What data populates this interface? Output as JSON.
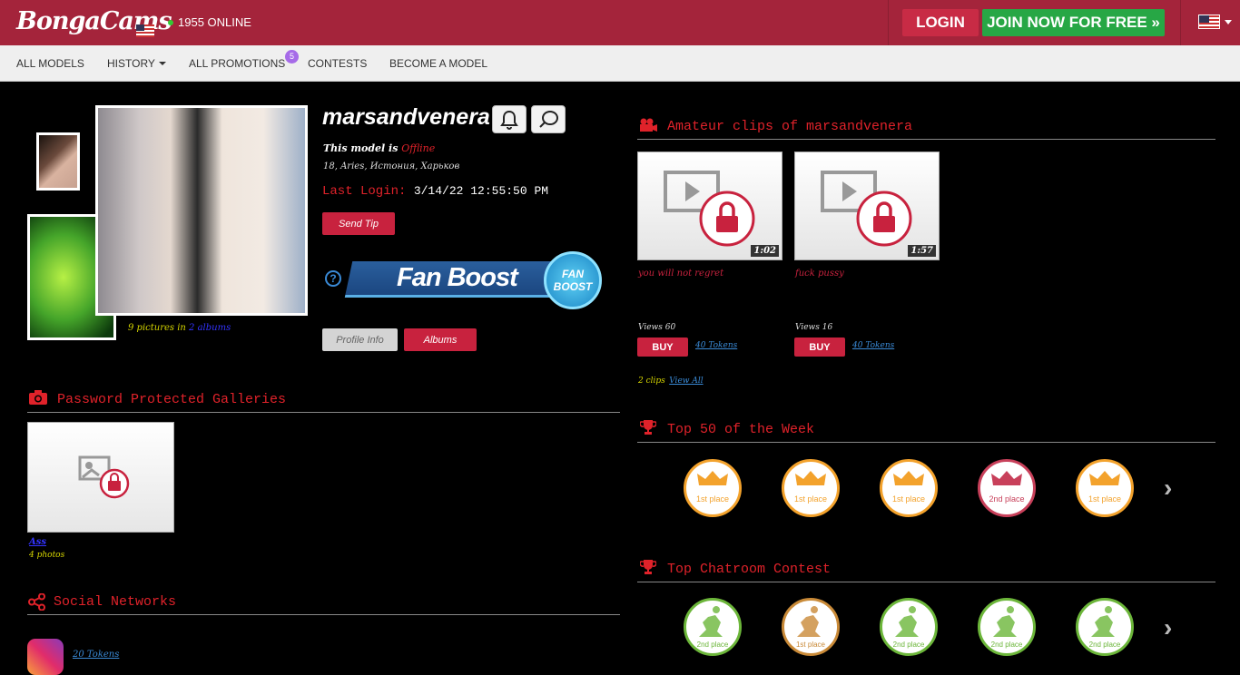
{
  "header": {
    "logo_text": "BongaCams",
    "online_text": "1955 ONLINE",
    "login_label": "LOGIN",
    "join_label": "JOIN NOW FOR FREE »",
    "lang_icon": "us-flag-icon"
  },
  "nav": {
    "items": [
      "ALL MODELS",
      "HISTORY",
      "ALL PROMOTIONS",
      "CONTESTS",
      "BECOME A MODEL"
    ],
    "promotions_badge": "5"
  },
  "profile": {
    "name": "marsandvenera",
    "status_prefix": "This model is",
    "status_value": "Offline",
    "info": "18, Aries, Истония, Харьков",
    "last_login_label": "Last Login:",
    "last_login_value": "3/14/22 12:55:50 PM",
    "send_tip_label": "Send Tip",
    "pictures_prefix": "9 pictures in",
    "pictures_link": "2 albums",
    "fan_boost_label": "Fan Boost",
    "fan_boost_badge": "FAN BOOST",
    "profile_info_label": "Profile Info",
    "albums_label": "Albums"
  },
  "galleries": {
    "title": "Password Protected Galleries",
    "items": [
      {
        "name": "Ass",
        "count": "4 photos"
      }
    ]
  },
  "social": {
    "title": "Social Networks",
    "instagram_price": "20 Tokens"
  },
  "clips": {
    "title": "Amateur clips of marsandvenera",
    "items": [
      {
        "duration": "1:02",
        "title": "you will not regret",
        "views": "Views 60",
        "buy": "BUY",
        "price": "40 Tokens"
      },
      {
        "duration": "1:57",
        "title": "fuck pussy",
        "views": "Views 16",
        "buy": "BUY",
        "price": "40 Tokens"
      }
    ],
    "count_text": "2 clips",
    "view_all": "View All"
  },
  "top50": {
    "title": "Top 50 of the Week",
    "medals": [
      {
        "place": "1st place",
        "color": "#f3a22c"
      },
      {
        "place": "1st place",
        "color": "#f3a22c"
      },
      {
        "place": "1st place",
        "color": "#f3a22c"
      },
      {
        "place": "2nd place",
        "color": "#c8405a"
      },
      {
        "place": "1st place",
        "color": "#f3a22c"
      }
    ]
  },
  "chatroom": {
    "title": "Top Chatroom Contest",
    "medals": [
      {
        "place": "2nd place",
        "color": "#6cb63a"
      },
      {
        "place": "1st place",
        "color": "#c98a38"
      },
      {
        "place": "2nd place",
        "color": "#6cb63a"
      },
      {
        "place": "2nd place",
        "color": "#6cb63a"
      },
      {
        "place": "2nd place",
        "color": "#6cb63a"
      }
    ]
  },
  "colors": {
    "brand": "#a4243b",
    "accent_red": "#e0222a",
    "join_green": "#27a745"
  }
}
